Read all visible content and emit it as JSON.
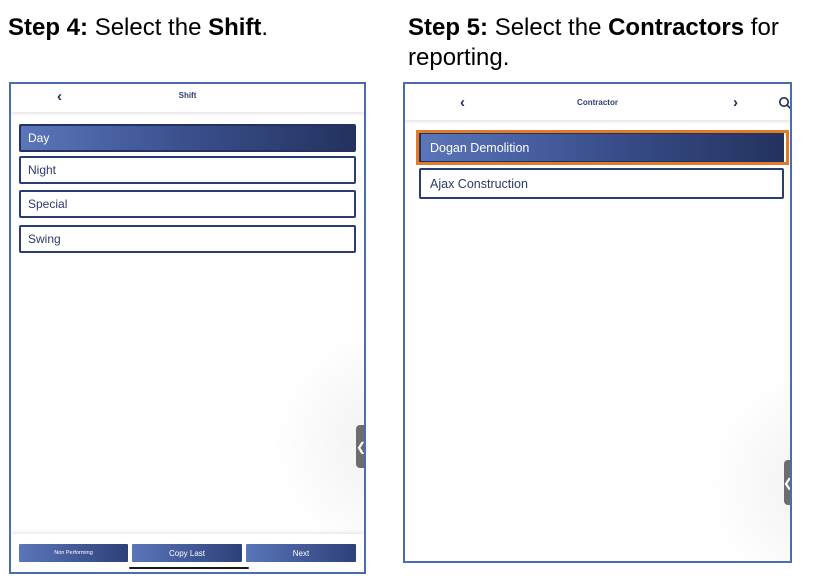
{
  "step4": {
    "caption_step": "Step 4:",
    "caption_pre": "Select the",
    "caption_bold": "Shift",
    "caption_post": ".",
    "screen": {
      "title": "Shift",
      "back_icon": "‹",
      "items": [
        {
          "label": "Day",
          "selected": true
        },
        {
          "label": "Night",
          "selected": false
        },
        {
          "label": "Special",
          "selected": false
        },
        {
          "label": "Swing",
          "selected": false
        }
      ],
      "handle_icon": "❮",
      "buttons": {
        "non_performing": "Non Performing",
        "copy_last": "Copy Last",
        "next": "Next"
      }
    }
  },
  "step5": {
    "caption_step": "Step 5:",
    "caption_pre": "Select the",
    "caption_bold": "Contractors",
    "caption_post": "for reporting.",
    "screen": {
      "title": "Contractor",
      "back_icon": "‹",
      "forward_icon": "›",
      "items": [
        {
          "label": "Dogan Demolition",
          "selected": true
        },
        {
          "label": "Ajax Construction",
          "selected": false
        }
      ],
      "handle_icon": "❮"
    }
  },
  "colors": {
    "accent_dark": "#23325e",
    "accent_light": "#5a76b9",
    "frame_border": "#4a6db0",
    "highlight": "#e27a2b"
  }
}
